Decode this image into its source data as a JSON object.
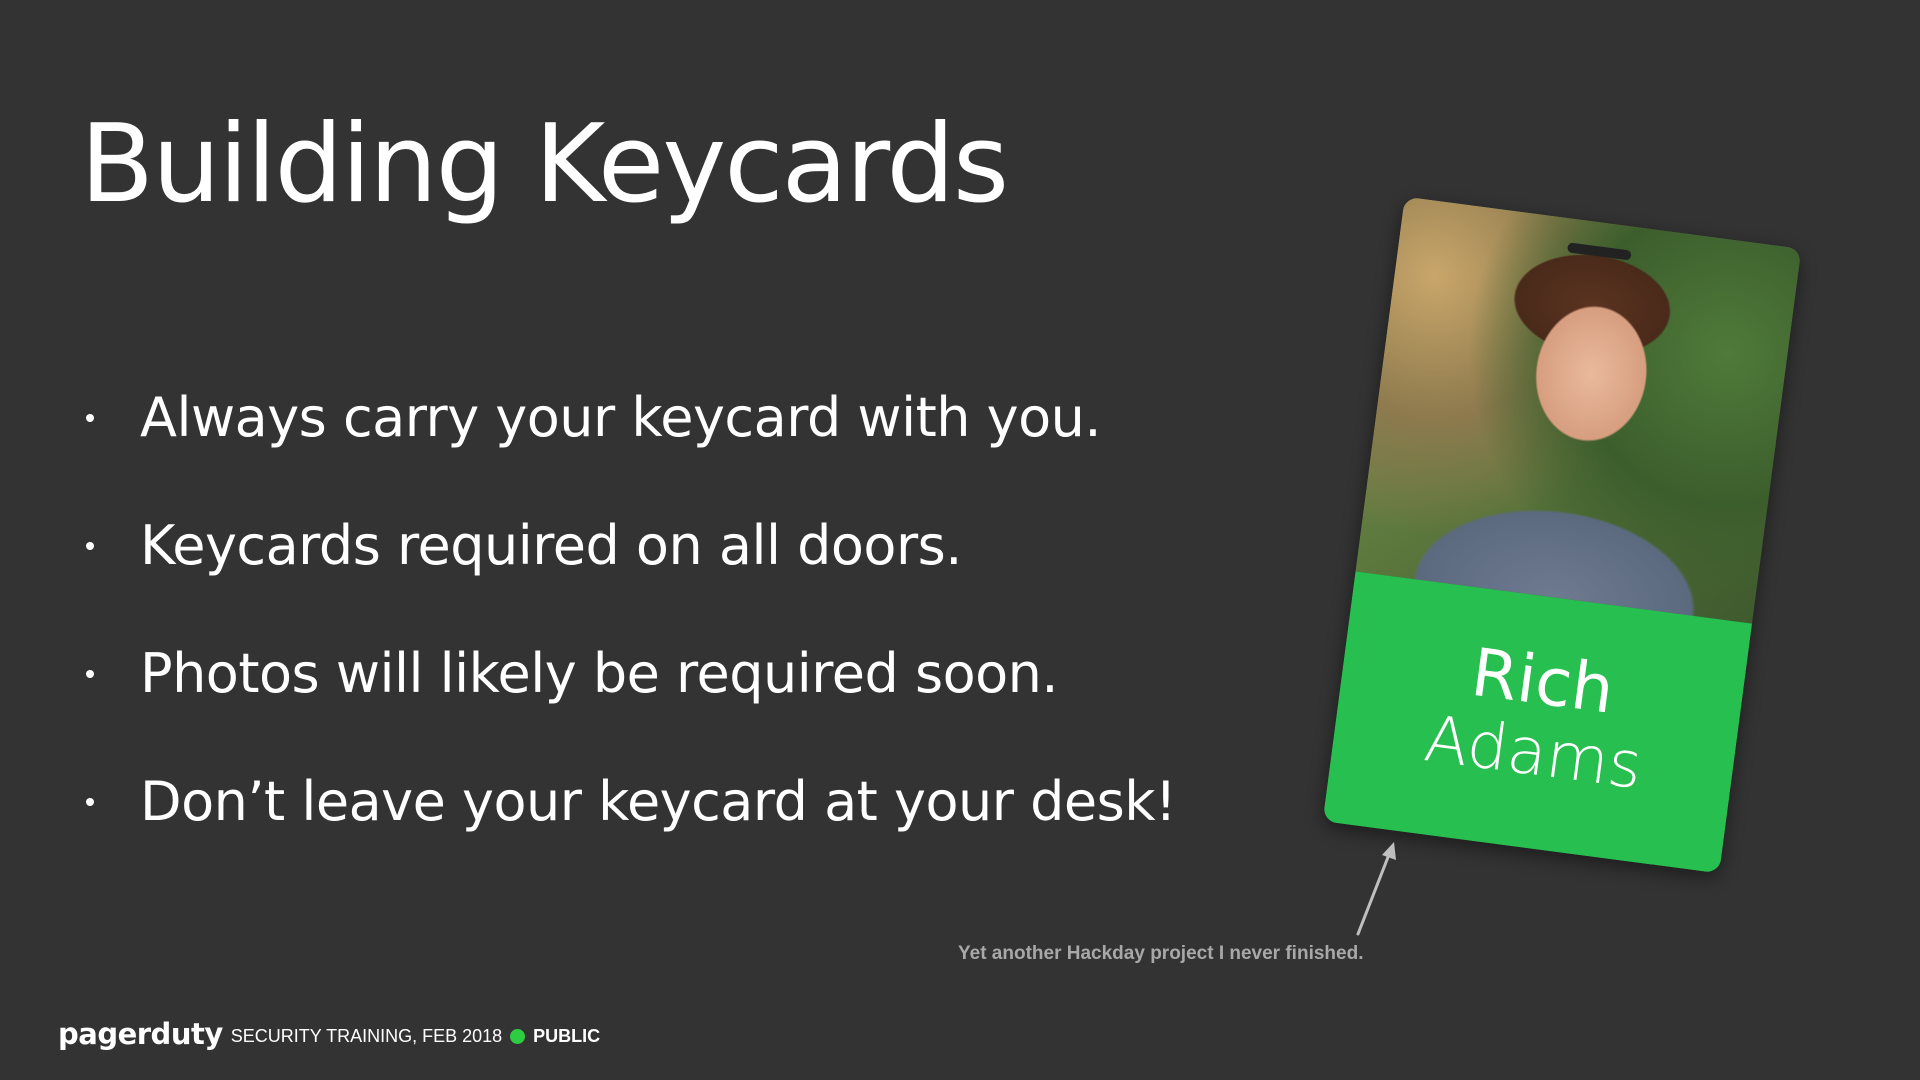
{
  "slide": {
    "title": "Building Keycards",
    "bullets": [
      "Always carry your keycard with you.",
      "Keycards required on all doors.",
      "Photos will likely be required soon.",
      "Don’t leave your keycard at your desk!"
    ]
  },
  "keycard": {
    "first_name": "Rich",
    "last_name": "Adams",
    "caption": "Yet another Hackday project I never finished.",
    "accent_color": "#27bf4f"
  },
  "footer": {
    "brand": "pagerduty",
    "event": "SECURITY TRAINING, FEB 2018",
    "classification": "PUBLIC",
    "classification_color": "#2ecc40"
  }
}
